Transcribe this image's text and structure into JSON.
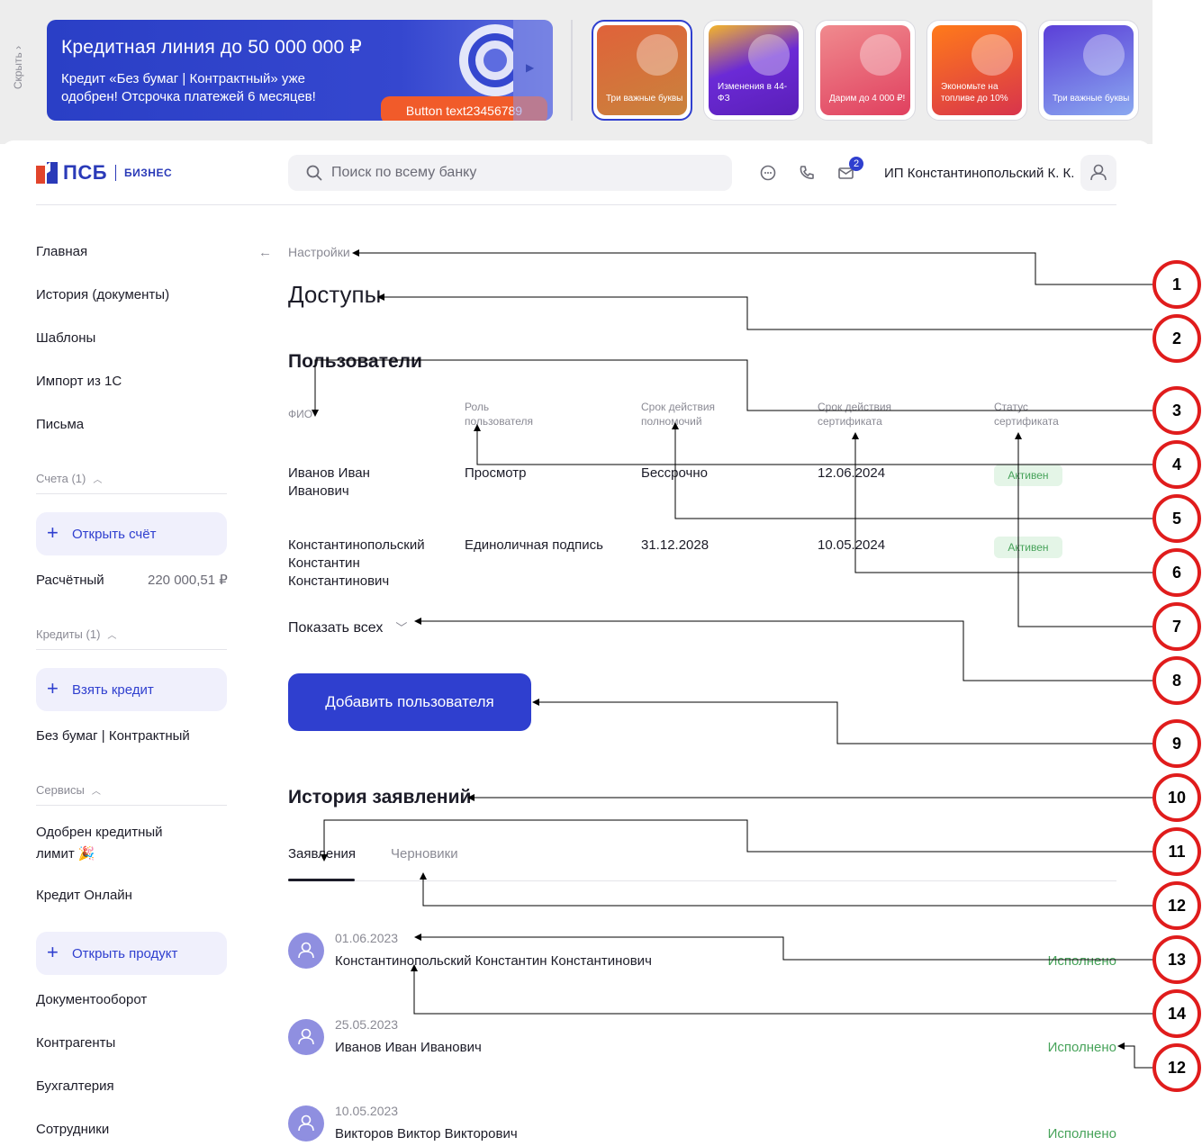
{
  "promo": {
    "hide_label": "Скрыть ›",
    "hero": {
      "title": "Кредитная линия до 50 000 000 ₽",
      "text": "Кредит «Без бумаг | Контрактный» уже одобрен! Отсрочка платежей 6 месяцев!",
      "button": "Button text23456789"
    },
    "stories": [
      {
        "label": "Три важные буквы",
        "color": "#e0623a"
      },
      {
        "label": "Изменения в 44-ФЗ",
        "color": "#6b2ad6"
      },
      {
        "label": "Дарим до 4 000 ₽!",
        "color": "#e84a6a"
      },
      {
        "label": "Экономьте на топливе до 10%",
        "color": "#ef5a1e"
      },
      {
        "label": "Три важные буквы",
        "color": "#6c63e6"
      }
    ]
  },
  "header": {
    "logo_text": "ПСБ",
    "logo_sub": "БИЗНЕС",
    "search_placeholder": "Поиск по всему банку",
    "notifications_count": "2",
    "user_name": "ИП Константинопольский К. К."
  },
  "sidebar": {
    "items_top": [
      "Главная",
      "История (документы)",
      "Шаблоны",
      "Импорт из 1С",
      "Письма"
    ],
    "accounts": {
      "title": "Счета (1)",
      "open_button": "Открыть счёт",
      "account_name": "Расчётный",
      "account_amount": "220 000,51 ₽"
    },
    "credits": {
      "title": "Кредиты (1)",
      "take_button": "Взять кредит",
      "credit_name": "Без бумаг | Контрактный"
    },
    "services": {
      "title": "Сервисы",
      "approved": "Одобрен кредитный лимит 🎉",
      "online": "Кредит Онлайн",
      "open_product": "Открыть продукт"
    },
    "items_bottom": [
      "Документооборот",
      "Контрагенты",
      "Бухгалтерия",
      "Сотрудники"
    ]
  },
  "main": {
    "breadcrumb": "Настройки",
    "title": "Доступы",
    "users_title": "Пользователи",
    "columns": {
      "fio": "ФИО",
      "role_1": "Роль",
      "role_2": "пользователя",
      "term_1": "Срок действия",
      "term_2": "полномочий",
      "cert_1": "Срок действия",
      "cert_2": "сертификата",
      "status_1": "Статус",
      "status_2": "сертификата"
    },
    "users": [
      {
        "fio_1": "Иванов Иван",
        "fio_2": "Иванович",
        "fio_3": "",
        "role": "Просмотр",
        "term": "Бессрочно",
        "cert": "12.06.2024",
        "status": "Активен"
      },
      {
        "fio_1": "Константинопольский",
        "fio_2": "Константин",
        "fio_3": "Константинович",
        "role": "Единоличная подпись",
        "term": "31.12.2028",
        "cert": "10.05.2024",
        "status": "Активен"
      }
    ],
    "show_all": "Показать всех",
    "add_user": "Добавить пользователя",
    "history_title": "История заявлений",
    "tabs": [
      "Заявления",
      "Черновики"
    ],
    "applications": [
      {
        "date": "01.06.2023",
        "name": "Константинопольский Константин Константинович",
        "status": "Исполнено"
      },
      {
        "date": "25.05.2023",
        "name": "Иванов Иван Иванович",
        "status": "Исполнено"
      },
      {
        "date": "10.05.2023",
        "name": "Викторов Виктор Викторович",
        "status": "Исполнено"
      }
    ]
  },
  "annotations": [
    "1",
    "2",
    "3",
    "4",
    "5",
    "6",
    "7",
    "8",
    "9",
    "10",
    "11",
    "12",
    "13",
    "14",
    "12"
  ],
  "colors": {
    "brand": "#2f3fcf",
    "marker_ring": "#e01c1c",
    "status_green": "#47a35a",
    "promo_button": "#f15b2a"
  }
}
